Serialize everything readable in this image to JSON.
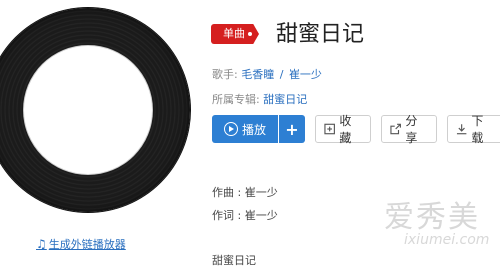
{
  "tag": "单曲",
  "song_title": "甜蜜日记",
  "singer": {
    "label": "歌手:",
    "names": [
      "毛香瞳",
      "崔一少"
    ],
    "separator": "/"
  },
  "album": {
    "label": "所属专辑:",
    "name": "甜蜜日记"
  },
  "buttons": {
    "play": "播放",
    "add": "+",
    "collect": "收藏",
    "share": "分享",
    "download": "下载"
  },
  "external_link": "生成外链播放器",
  "credits": {
    "composer": "作曲 : 崔一少",
    "lyricist": "作词 : 崔一少"
  },
  "lyric_preview": "甜蜜日记",
  "watermark": {
    "cn": "爱秀美",
    "en": "ixiumei.com"
  },
  "colors": {
    "accent": "#2d7fd3",
    "tag": "#d51f1f",
    "link": "#2a6fbf"
  },
  "icons": [
    "music-note-icon",
    "play-circle-icon",
    "plus-icon",
    "collect-icon",
    "share-icon",
    "download-icon"
  ]
}
